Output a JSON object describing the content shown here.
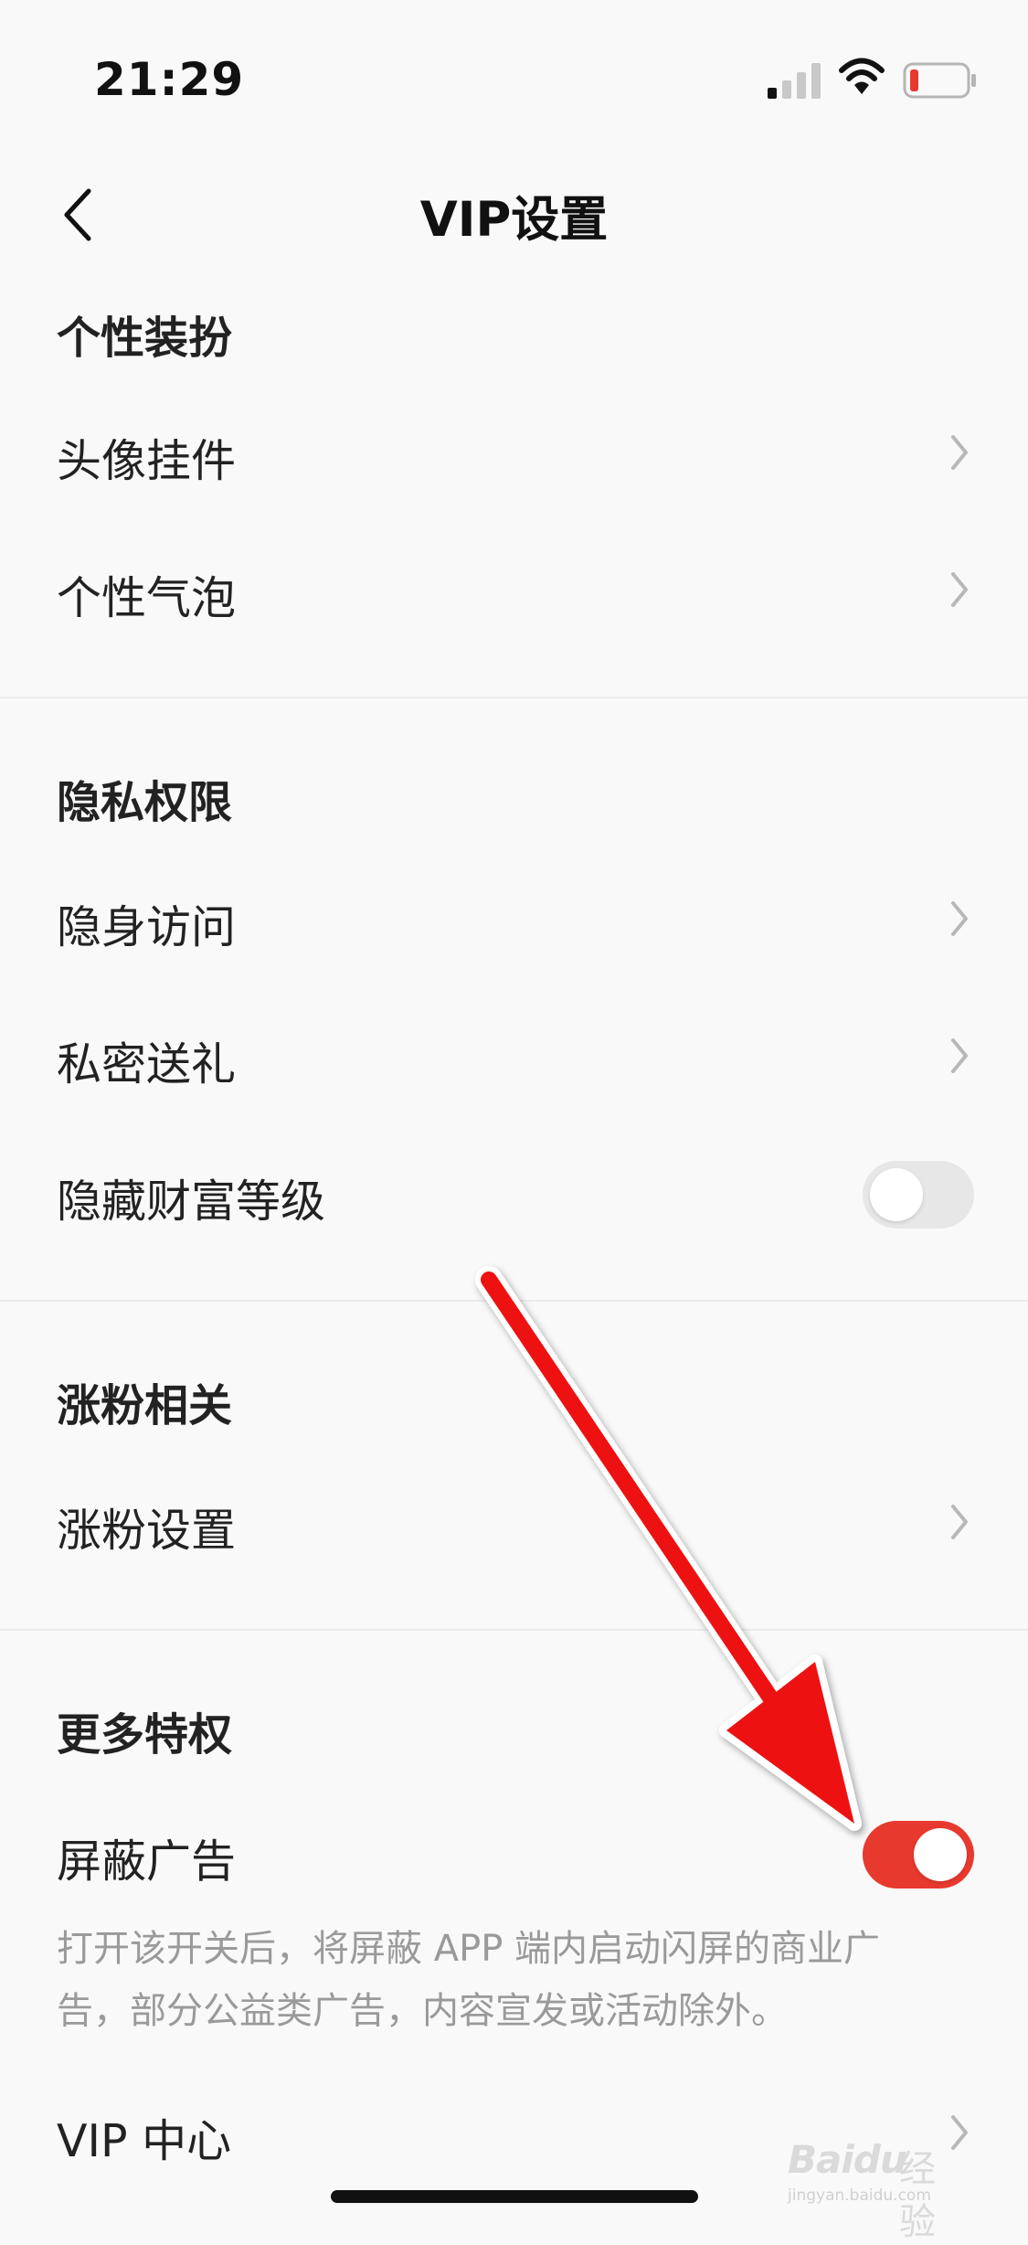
{
  "status": {
    "time": "21:29"
  },
  "header": {
    "title": "VIP设置"
  },
  "sections": [
    {
      "title": "个性装扮",
      "items": [
        {
          "label": "头像挂件",
          "control": "chevron"
        },
        {
          "label": "个性气泡",
          "control": "chevron"
        }
      ]
    },
    {
      "title": "隐私权限",
      "items": [
        {
          "label": "隐身访问",
          "control": "chevron"
        },
        {
          "label": "私密送礼",
          "control": "chevron"
        },
        {
          "label": "隐藏财富等级",
          "control": "toggle",
          "on": false
        }
      ]
    },
    {
      "title": "涨粉相关",
      "items": [
        {
          "label": "涨粉设置",
          "control": "chevron"
        }
      ]
    },
    {
      "title": "更多特权",
      "items": [
        {
          "label": "屏蔽广告",
          "control": "toggle",
          "on": true
        },
        {
          "label": "VIP 中心",
          "control": "chevron"
        }
      ]
    }
  ],
  "ad_block_description": "打开该开关后，将屏蔽 APP 端内启动闪屏的商业广告，部分公益类广告，内容宣发或活动除外。",
  "watermark": {
    "brand": "Baidu",
    "cn": "经验",
    "url": "jingyan.baidu.com"
  },
  "colors": {
    "accent": "#e8392f",
    "annotation_arrow": "#ee1111"
  }
}
